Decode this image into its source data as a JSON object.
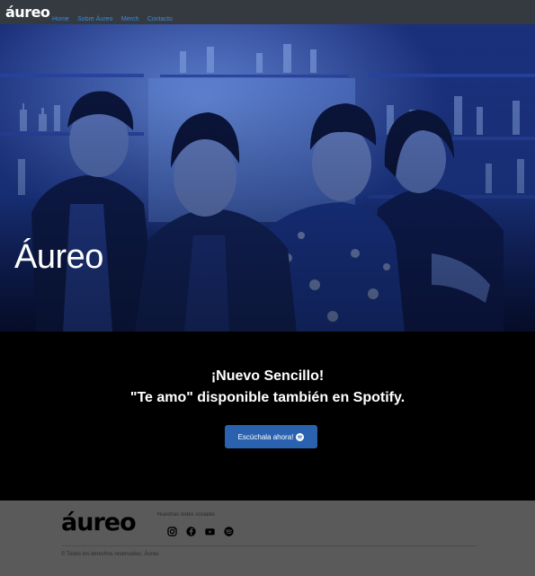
{
  "nav": {
    "brand": "áureo",
    "links": [
      "Home",
      "Sobre Áureo",
      "Merch",
      "Contacto"
    ]
  },
  "hero": {
    "title": "Áureo"
  },
  "promo": {
    "line1": "¡Nuevo Sencillo!",
    "line2": "\"Te amo\" disponible también en Spotify.",
    "button_label": "Escúchala ahora!",
    "button_icon": "spotify-icon"
  },
  "footer": {
    "logo": "áureo",
    "social_heading": "Nuestras redes sociales",
    "social_icons": [
      "instagram-icon",
      "facebook-icon",
      "youtube-icon",
      "spotify-icon"
    ],
    "copyright": "© Todos los derechos reservados. Áureo"
  },
  "colors": {
    "navbar_bg": "#343a40",
    "nav_link": "#3b8bd9",
    "hero_tint": "#1a3ca8",
    "promo_bg": "#000000",
    "button_bg": "#2a62b0",
    "footer_bg": "#5a5a5a"
  }
}
